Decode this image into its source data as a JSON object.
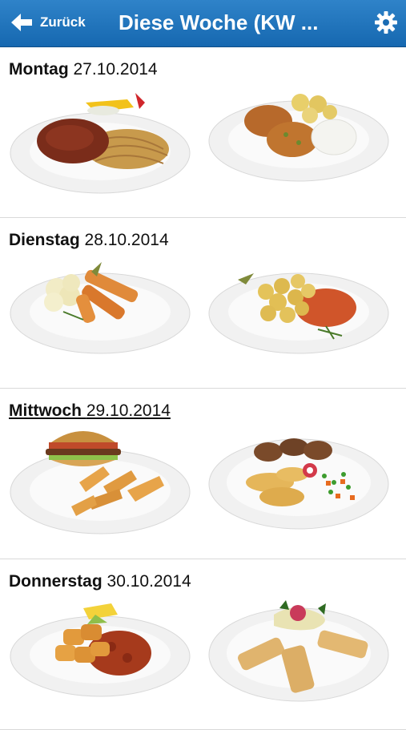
{
  "header": {
    "back_label": "Zurück",
    "title": "Diese Woche (KW ...",
    "back_icon": "arrow-left-icon",
    "settings_icon": "gear-icon",
    "bar_color": "#1f74bd"
  },
  "days": [
    {
      "name": "Montag",
      "date": "27.10.2014",
      "meals": [
        {
          "icon": "spaghetti-bolognese-dish"
        },
        {
          "icon": "fish-cakes-potatoes-dish"
        }
      ]
    },
    {
      "name": "Dienstag",
      "date": "28.10.2014",
      "meals": [
        {
          "icon": "fish-fingers-mash-dish"
        },
        {
          "icon": "potatoes-sauce-dish"
        }
      ]
    },
    {
      "name": "Mittwoch",
      "date": "29.10.2014",
      "meals": [
        {
          "icon": "burger-wedges-dish"
        },
        {
          "icon": "meatballs-vegetables-dish"
        }
      ]
    },
    {
      "name": "Donnerstag",
      "date": "30.10.2014",
      "meals": [
        {
          "icon": "nuggets-sauce-dish"
        },
        {
          "icon": "fish-sticks-salad-dish"
        }
      ]
    }
  ]
}
